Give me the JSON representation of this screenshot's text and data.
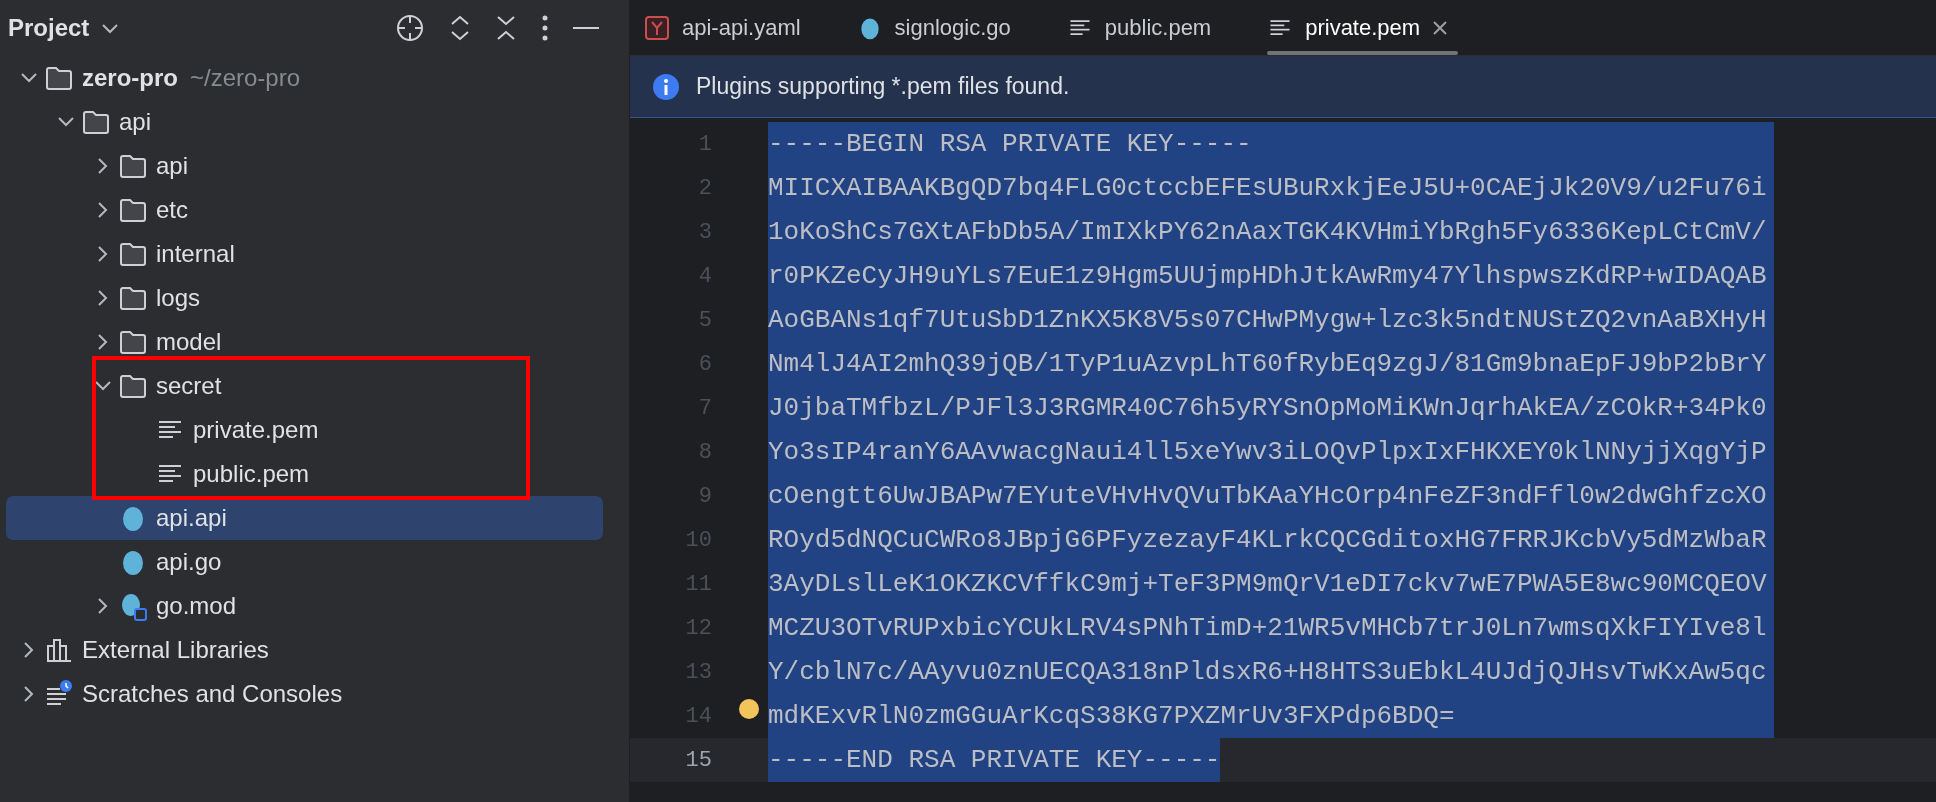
{
  "sidebar": {
    "title": "Project",
    "tree": [
      {
        "name": "zero-pro",
        "path": "~/zero-pro",
        "kind": "folder",
        "expanded": true,
        "selected": false,
        "annotated": false,
        "children": [
          {
            "name": "api",
            "kind": "folder",
            "expanded": true,
            "selected": false,
            "annotated": false,
            "children": [
              {
                "name": "api",
                "kind": "folder",
                "expanded": false,
                "selected": false,
                "annotated": false
              },
              {
                "name": "etc",
                "kind": "folder",
                "expanded": false,
                "selected": false,
                "annotated": false
              },
              {
                "name": "internal",
                "kind": "folder",
                "expanded": false,
                "selected": false,
                "annotated": false
              },
              {
                "name": "logs",
                "kind": "folder",
                "expanded": false,
                "selected": false,
                "annotated": false
              },
              {
                "name": "model",
                "kind": "folder",
                "expanded": false,
                "selected": false,
                "annotated": false
              },
              {
                "name": "secret",
                "kind": "folder",
                "expanded": true,
                "selected": false,
                "annotated": true,
                "children": [
                  {
                    "name": "private.pem",
                    "kind": "text",
                    "selected": false,
                    "annotated": false
                  },
                  {
                    "name": "public.pem",
                    "kind": "text",
                    "selected": false,
                    "annotated": false
                  }
                ]
              },
              {
                "name": "api.api",
                "kind": "gopher",
                "selected": true,
                "annotated": false
              },
              {
                "name": "api.go",
                "kind": "gopher",
                "selected": false,
                "annotated": false
              },
              {
                "name": "go.mod",
                "kind": "gomod",
                "expanded": false,
                "selected": false,
                "annotated": false
              }
            ]
          }
        ]
      },
      {
        "name": "External Libraries",
        "kind": "library",
        "expanded": false,
        "selected": false,
        "annotated": false
      },
      {
        "name": "Scratches and Consoles",
        "kind": "scratch",
        "expanded": false,
        "selected": false,
        "annotated": false
      }
    ]
  },
  "tabs": [
    {
      "label": "api-api.yaml",
      "kind": "yaml",
      "selected": false
    },
    {
      "label": "signlogic.go",
      "kind": "gopher",
      "selected": false
    },
    {
      "label": "public.pem",
      "kind": "text",
      "selected": false
    },
    {
      "label": "private.pem",
      "kind": "text",
      "selected": true
    }
  ],
  "banner": {
    "kind": "info",
    "text": "Plugins supporting *.pem files found."
  },
  "editor": {
    "lines": [
      {
        "number": "1",
        "text": "-----BEGIN RSA PRIVATE KEY-----",
        "selected": true,
        "current": false,
        "bulb": false
      },
      {
        "number": "2",
        "text": "MIICXAIBAAKBgQD7bq4FLG0ctccbEFEsUBuRxkjEeJ5U+0CAEjJk20V9/u2Fu76i",
        "selected": true,
        "current": false,
        "bulb": false
      },
      {
        "number": "3",
        "text": "1oKoShCs7GXtAFbDb5A/ImIXkPY62nAaxTGK4KVHmiYbRgh5Fy6336KepLCtCmV/",
        "selected": true,
        "current": false,
        "bulb": false
      },
      {
        "number": "4",
        "text": "r0PKZeCyJH9uYLs7EuE1z9Hgm5UUjmpHDhJtkAwRmy47YlhspwszKdRP+wIDAQAB",
        "selected": true,
        "current": false,
        "bulb": false
      },
      {
        "number": "5",
        "text": "AoGBANs1qf7UtuSbD1ZnKX5K8V5s07CHwPMygw+lzc3k5ndtNUStZQ2vnAaBXHyH",
        "selected": true,
        "current": false,
        "bulb": false
      },
      {
        "number": "6",
        "text": "Nm4lJ4AI2mhQ39jQB/1TyP1uAzvpLhT60fRybEq9zgJ/81Gm9bnaEpFJ9bP2bBrY",
        "selected": true,
        "current": false,
        "bulb": false
      },
      {
        "number": "7",
        "text": "J0jbaTMfbzL/PJFl3J3RGMR40C76h5yRYSnOpMoMiKWnJqrhAkEA/zCOkR+34Pk0",
        "selected": true,
        "current": false,
        "bulb": false
      },
      {
        "number": "8",
        "text": "Yo3sIP4ranY6AAvwacgNaui4ll5xeYwv3iLOQvPlpxIxFHKXEY0klNNyjjXqgYjP",
        "selected": true,
        "current": false,
        "bulb": false
      },
      {
        "number": "9",
        "text": "cOengtt6UwJBAPw7EYuteVHvHvQVuTbKAaYHcOrp4nFeZF3ndFfl0w2dwGhfzcXO",
        "selected": true,
        "current": false,
        "bulb": false
      },
      {
        "number": "10",
        "text": "ROyd5dNQCuCWRo8JBpjG6PFyzezayF4KLrkCQCGditoxHG7FRRJKcbVy5dMzWbaR",
        "selected": true,
        "current": false,
        "bulb": false
      },
      {
        "number": "11",
        "text": "3AyDLslLeK1OKZKCVffkC9mj+TeF3PM9mQrV1eDI7ckv7wE7PWA5E8wc90MCQEOV",
        "selected": true,
        "current": false,
        "bulb": false
      },
      {
        "number": "12",
        "text": "MCZU3OTvRUPxbicYCUkLRV4sPNhTimD+21WR5vMHCb7trJ0Ln7wmsqXkFIYIve8l",
        "selected": true,
        "current": false,
        "bulb": false
      },
      {
        "number": "13",
        "text": "Y/cblN7c/AAyvu0znUECQA318nPldsxR6+H8HTS3uEbkL4UJdjQJHsvTwKxAw5qc",
        "selected": true,
        "current": false,
        "bulb": false
      },
      {
        "number": "14",
        "text": "mdKExvRlN0zmGGuArKcqS38KG7PXZMrUv3FXPdp6BDQ=",
        "selected": true,
        "current": false,
        "bulb": true
      },
      {
        "number": "15",
        "text": "-----END RSA PRIVATE KEY-----",
        "selected": true,
        "current": true,
        "bulb": false
      }
    ]
  }
}
